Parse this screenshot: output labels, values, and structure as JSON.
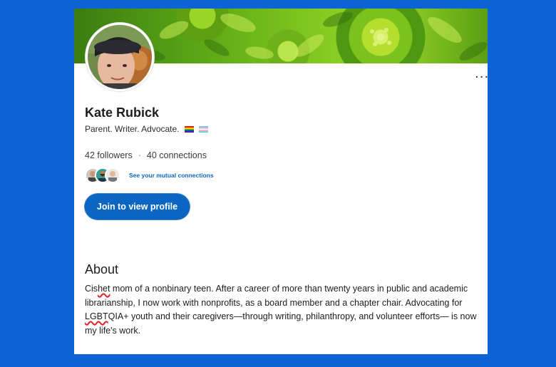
{
  "profile": {
    "name": "Kate Rubick",
    "headline": "Parent. Writer. Advocate.",
    "followers": "42 followers",
    "separator": "·",
    "connections": "40 connections",
    "mutual_link": "See your mutual connections",
    "join_button": "Join to view profile",
    "more_menu": "···"
  },
  "about": {
    "heading": "About",
    "text_1a": "Cis",
    "text_1b": "het",
    "text_1c": " mom of a nonbinary teen. After a career of more than twenty years in public and academic librarianship, I now work with nonprofits, as a board member and a chapter chair. Advocating for ",
    "text_2a": "LGBT",
    "text_2b": "QIA+ youth and their caregivers—through writing, philanthropy, and volunteer efforts— is now my life's work."
  },
  "colors": {
    "page_bg": "#0b63d6",
    "card_bg": "#ffffff",
    "button_blue": "#0a66c2",
    "spellcheck_red": "#e0232a"
  },
  "icons": {
    "rainbow_flag": "rainbow-flag-icon",
    "trans_flag": "trans-flag-icon",
    "more_menu": "more-horizontal-icon"
  }
}
